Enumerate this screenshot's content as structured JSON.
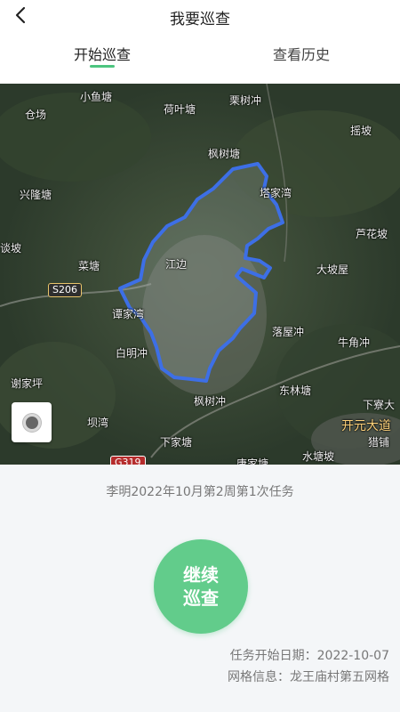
{
  "header": {
    "title": "我要巡查",
    "back_icon": "chevron-left-icon"
  },
  "tabs": [
    {
      "label": "开始巡查",
      "active": true
    },
    {
      "label": "查看历史",
      "active": false
    }
  ],
  "colors": {
    "accent": "#4cc57f",
    "button": "#62cc8b",
    "boundary": "#3d6fe6"
  },
  "map": {
    "place_labels": [
      "小鱼塘",
      "荷叶塘",
      "栗树冲",
      "仓场",
      "摇坡",
      "枫树塘",
      "兴隆塘",
      "塔家湾",
      "芦花坡",
      "谈坡",
      "菜塘",
      "江边",
      "大坡屋",
      "谭家湾",
      "落屋冲",
      "牛角冲",
      "白明冲",
      "谢家坪",
      "枫树冲",
      "东林塘",
      "下寮大",
      "坝湾",
      "开元大道",
      "猎铺",
      "下家塘",
      "水塘坡",
      "唐家塘"
    ],
    "road_labels": [
      "S206",
      "G319"
    ],
    "locate_icon": "locate-icon"
  },
  "task": {
    "name": "李明2022年10月第2周第1次任务",
    "button_line1": "继续",
    "button_line2": "巡查",
    "start_date": "任务开始日期：2022-10-07",
    "grid_info": "网格信息：龙王庙村第五网格"
  }
}
